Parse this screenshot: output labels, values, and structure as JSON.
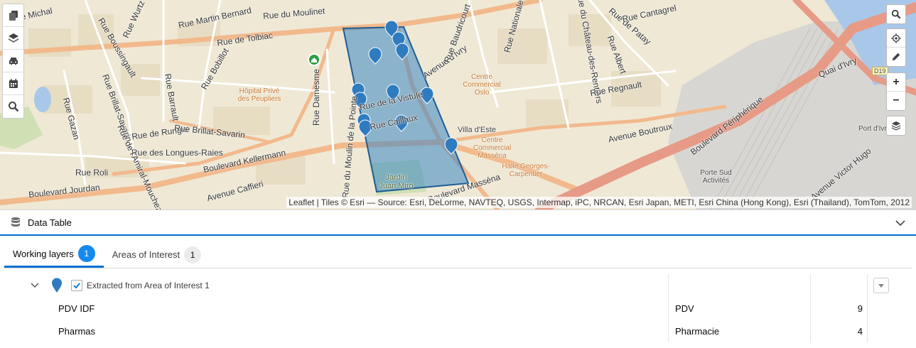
{
  "map": {
    "attribution": "Leaflet | Tiles © Esri — Source: Esri, DeLorme, NAVTEQ, USGS, Intermap, iPC, NRCAN, Esri Japan, METI, Esri China (Hong Kong), Esri (Thailand), TomTom, 2012",
    "labels": {
      "rue_michal": "Rue Michal",
      "rue_martin_bernard": "Rue Martin Bernard",
      "rue_du_moulinet": "Rue du Moulinet",
      "rue_wurtz": "Rue Wurtz",
      "rue_de_tolbiac": "Rue de Tolbiac",
      "rue_boussingault": "Rue Boussingault",
      "rue_bobillot": "Rue Bobillot",
      "rue_damesme": "Rue Damesme",
      "hopital": "Hôpital Privé des Peupliers",
      "rue_de_la_vistule": "Rue de la Vistule",
      "rue_caillaux": "Rue Caillaux",
      "avenue_divry": "Avenue d'Ivry",
      "centre_oslo": "Centre Commercial Oslo",
      "rue_du_chateau": "Rue du Château-des-Rentiers",
      "rue_albert": "Rue Albert",
      "rue_de_patay": "Rue de Patay",
      "rue_cantagrel": "Rue Cantagrel",
      "rue_regnault": "Rue Regnault",
      "avenue_boutroux": "Avenue Boutroux",
      "boulevard_peripherique": "Boulevard Périphérique",
      "quai_divry": "Quai d'Ivry",
      "rue_de_rungis": "Rue de Rungis",
      "rue_brillat_savarin": "Rue Brillat-Savarin",
      "rue_des_longues_raies": "Rue des Longues-Raies",
      "boulevard_kellermann": "Boulevard Kellermann",
      "rue_roli": "Rue Roli",
      "boulevard_jourdan": "Boulevard Jourdan",
      "avenue_caffieri": "Avenue Caffieri",
      "villa_deste": "Villa d'Este",
      "centre_massena": "Centre Commercial Masséna",
      "halle_carpentier": "Halle Georges-Carpentier",
      "jardin_juan_miro": "Jardin Juan Miro",
      "porte_sud": "Porte Sud Activités",
      "avenue_victor_hugo": "Avenue Victor Hugo",
      "port_divry": "Port d'Ivry",
      "rue_nationale": "Rue Nationale",
      "rue_baudricourt": "Rue Baudricourt",
      "rue_barrault": "Rue Barrault",
      "rue_gazan": "Rue Gazan",
      "rue_brillat": "Rue Brillat-Savarin",
      "rue_de_lamiral": "Rue de l'Amiral-Mouchez",
      "boulevard_massena": "Boulevard Masséna",
      "rue_du_moulin": "Rue du Moulin de la Pointe",
      "d19": "D19"
    }
  },
  "panel": {
    "title": "Data Table",
    "tabs": [
      {
        "label": "Working layers",
        "count": "1"
      },
      {
        "label": "Areas of Interest",
        "count": "1"
      }
    ],
    "group_label": "Extracted from Area of Interest 1",
    "rows": [
      {
        "name": "PDV IDF",
        "type": "PDV",
        "count": "9"
      },
      {
        "name": "Pharmas",
        "type": "Pharmacie",
        "count": "4"
      }
    ]
  },
  "colors": {
    "accent": "#0070d2",
    "pin": "#2f7bbf",
    "polygon": "#3a86c4",
    "pharmacy_pin": "#2e9e46"
  }
}
